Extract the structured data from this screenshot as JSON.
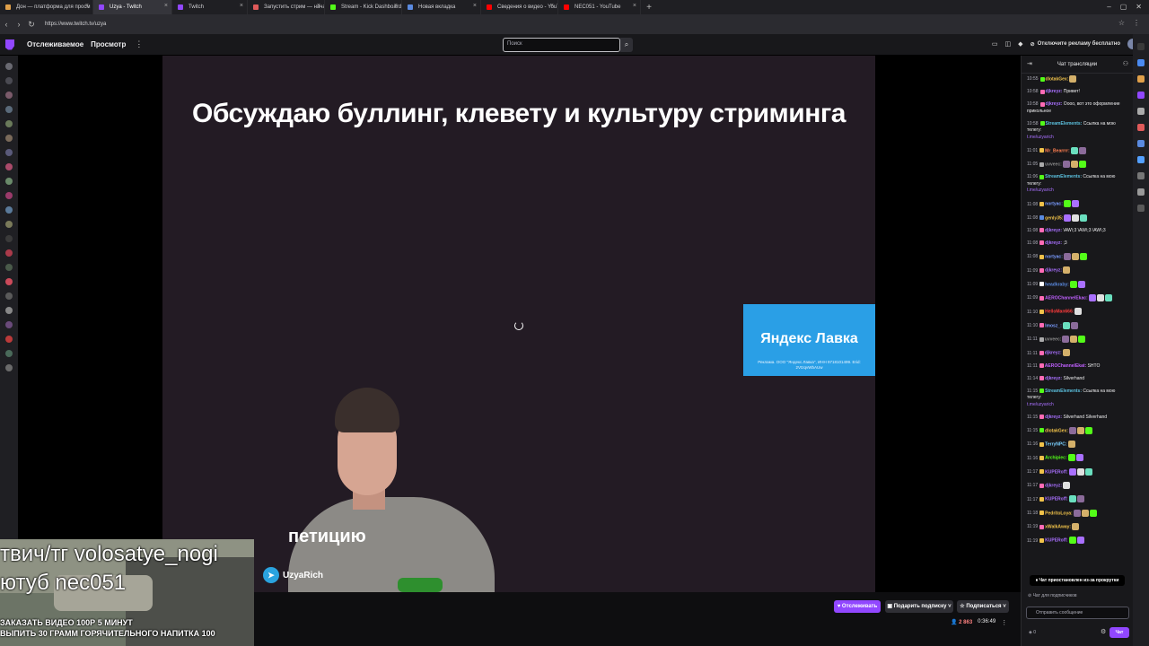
{
  "browser": {
    "tabs": [
      {
        "label": "Дон — платформа для просм",
        "color": "#e0a04a",
        "active": false
      },
      {
        "label": "Uzya - Twitch",
        "color": "#9147ff",
        "active": true
      },
      {
        "label": "Twitch",
        "color": "#9147ff",
        "active": false
      },
      {
        "label": "Запустить стрим — начать пря",
        "color": "#e05a5a",
        "active": false
      },
      {
        "label": "Stream - Kick Dashboard",
        "color": "#53fc18",
        "active": false
      },
      {
        "label": "Новая вкладка",
        "color": "#5a8ae0",
        "active": false
      },
      {
        "label": "Сведения о видео - YouTube St",
        "color": "#ff0000",
        "active": false
      },
      {
        "label": "NEC051 - YouTube",
        "color": "#ff0000",
        "active": false
      }
    ],
    "url": "https://www.twitch.tv/uzya"
  },
  "topnav": {
    "following": "Отслеживаемое",
    "browse": "Просмотр",
    "search_placeholder": "Поиск",
    "adfree": "Отключите рекламу бесплатно"
  },
  "stream": {
    "title": "Обсуждаю буллинг, клевету и культуру стриминга",
    "ad_brand": "Яндекс Лавка",
    "ad_fine": "Реклама. ООО \"Яндекс.Лавка\", ИНН 9718101499. Erid: 2VtzqvWbAUw",
    "petition": "петицию",
    "telegram": "UzyaRich",
    "overlay_line1": "твич/тг volosatye_nogi",
    "overlay_line2": "ютуб nec051",
    "overlay_line3": "ЗАКАЗАТЬ ВИДЕО 100Р 5 МИНУТ",
    "overlay_line4": "ВЫПИТЬ 30 ГРАММ ГОРЯЧИТЕЛЬНОГО НАПИТКА 100"
  },
  "actions": {
    "follow": "Отслеживать",
    "gift": "Подарить подписку",
    "subscribe": "Подписаться",
    "viewers": "2 863",
    "uptime": "0:36:49"
  },
  "chat": {
    "header": "Чат трансляции",
    "messages": [
      {
        "time": "10:55",
        "nick": "dlotakGex:",
        "color": "#f0c24a",
        "text": "",
        "badge": "#53fc18"
      },
      {
        "time": "10:58",
        "nick": "djkreyz:",
        "color": "#a970ff",
        "text": "Привет!",
        "badge": "#ff6bb5"
      },
      {
        "time": "10:58",
        "nick": "djkreyz:",
        "color": "#a970ff",
        "text": "Оооо, вот это оформление прикольное",
        "badge": "#ff6bb5"
      },
      {
        "time": "10:58",
        "nick": "StreamElements:",
        "color": "#5bc0de",
        "text": "Ссылка на мою телегу:",
        "link": "t.me/uzyarich",
        "badge": "#53fc18"
      },
      {
        "time": "11:01",
        "nick": "Mr_Bearrrr:",
        "color": "#ff7f50",
        "text": "",
        "badge": "#f0c24a"
      },
      {
        "time": "11:05",
        "nick": "uvveec:",
        "color": "#8a8a8a",
        "text": "",
        "badge": "#aaaaaa"
      },
      {
        "time": "11:06",
        "nick": "StreamElements:",
        "color": "#5bc0de",
        "text": "Ссылка на мою телегу:",
        "link": "t.me/uzyarich",
        "badge": "#53fc18"
      },
      {
        "time": "11:08",
        "nick": "nortyac:",
        "color": "#7a9cff",
        "text": "",
        "badge": "#f0c24a"
      },
      {
        "time": "11:08",
        "nick": "genly35:",
        "color": "#f0c24a",
        "text": "",
        "badge": "#5a8ae0"
      },
      {
        "time": "11:08",
        "nick": "djkreyz:",
        "color": "#a970ff",
        "text": "\\AW\\;3 \\AW\\;3 \\AW\\;3",
        "badge": "#ff6bb5"
      },
      {
        "time": "11:08",
        "nick": "djkreyz:",
        "color": "#a970ff",
        "text": ";3",
        "badge": "#ff6bb5"
      },
      {
        "time": "11:08",
        "nick": "nortyac:",
        "color": "#7a9cff",
        "text": "",
        "badge": "#f0c24a"
      },
      {
        "time": "11:09",
        "nick": "djkreyz:",
        "color": "#a970ff",
        "text": "",
        "badge": "#ff6bb5"
      },
      {
        "time": "11:09",
        "nick": "headkraby:",
        "color": "#5a8ae0",
        "text": "",
        "badge": "#ffffff"
      },
      {
        "time": "11:09",
        "nick": "AEROChannelEkac:",
        "color": "#c060ff",
        "text": "",
        "badge": "#ff6bb5"
      },
      {
        "time": "11:10",
        "nick": "HelloMan666:",
        "color": "#ff3b3b",
        "text": "",
        "badge": "#f0c24a"
      },
      {
        "time": "11:10",
        "nick": "lmosz_:",
        "color": "#7a9cff",
        "text": "",
        "badge": "#ff6bb5"
      },
      {
        "time": "11:11",
        "nick": "uvveec:",
        "color": "#8a8a8a",
        "text": "",
        "badge": "#aaaaaa"
      },
      {
        "time": "11:11",
        "nick": "djkreyz:",
        "color": "#a970ff",
        "text": "",
        "badge": "#ff6bb5"
      },
      {
        "time": "11:11",
        "nick": "AEROChannelEkat:",
        "color": "#c060ff",
        "text": "SHTO",
        "badge": "#ff6bb5"
      },
      {
        "time": "11:14",
        "nick": "djkreyz:",
        "color": "#a970ff",
        "text": "Silverhand",
        "badge": "#ff6bb5"
      },
      {
        "time": "11:15",
        "nick": "StreamElements:",
        "color": "#5bc0de",
        "text": "Ссылка на мою телегу:",
        "link": "t.me/uzyarich",
        "badge": "#53fc18"
      },
      {
        "time": "11:15",
        "nick": "djkreyz:",
        "color": "#a970ff",
        "text": "Silverhand Silverhand",
        "badge": "#ff6bb5"
      },
      {
        "time": "11:15",
        "nick": "dlotakGex:",
        "color": "#f0c24a",
        "text": "",
        "badge": "#53fc18"
      },
      {
        "time": "11:16",
        "nick": "TerryNPC:",
        "color": "#7ad0ff",
        "text": "",
        "badge": "#f0c24a"
      },
      {
        "time": "11:16",
        "nick": "Archipiec:",
        "color": "#53fc18",
        "text": "",
        "badge": "#f0c24a"
      },
      {
        "time": "11:17",
        "nick": "KUPERoff:",
        "color": "#a970ff",
        "text": "",
        "badge": "#f0c24a"
      },
      {
        "time": "11:17",
        "nick": "djkreyz:",
        "color": "#a970ff",
        "text": "",
        "badge": "#ff6bb5"
      },
      {
        "time": "11:17",
        "nick": "KUPERoff:",
        "color": "#a970ff",
        "text": "",
        "badge": "#f0c24a"
      },
      {
        "time": "11:18",
        "nick": "PedritoLoya:",
        "color": "#f0c24a",
        "text": "",
        "badge": "#f0c24a"
      },
      {
        "time": "11:19",
        "nick": "xWalkAway:",
        "color": "#f0c24a",
        "text": "",
        "badge": "#ff6bb5"
      },
      {
        "time": "11:19",
        "nick": "KUPERoff:",
        "color": "#a970ff",
        "text": "",
        "badge": "#f0c24a"
      }
    ],
    "paused": "Чат приостановлен из-за прокрутки",
    "sub_only": "Чат для подписчиков",
    "input_placeholder": "Отправить сообщение",
    "points": "0",
    "send": "Чат"
  }
}
